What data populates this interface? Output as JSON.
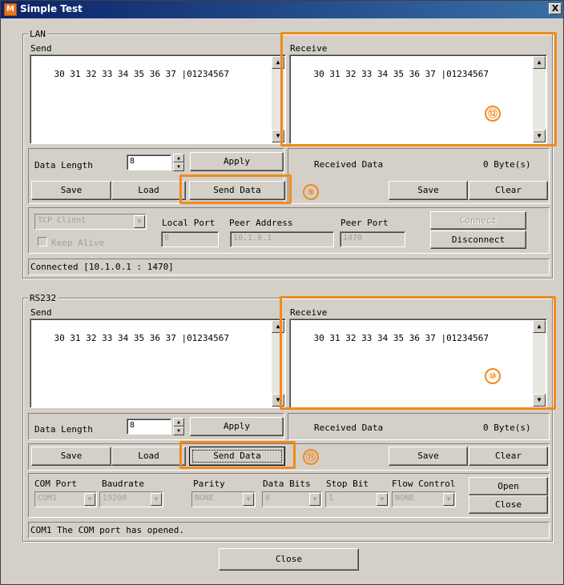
{
  "window": {
    "title": "Simple Test",
    "close_glyph": "X",
    "icon_letter": "M"
  },
  "lan": {
    "group_label": "LAN",
    "send_label": "Send",
    "send_text": "30 31 32 33 34 35 36 37 |01234567",
    "receive_label": "Receive",
    "receive_text": "30 31 32 33 34 35 36 37 |01234567",
    "data_length_label": "Data Length",
    "data_length_value": "8",
    "apply_label": "Apply",
    "received_data_label": "Received Data",
    "received_bytes": "0  Byte(s)",
    "save_label": "Save",
    "load_label": "Load",
    "send_data_label": "Send Data",
    "recv_save_label": "Save",
    "clear_label": "Clear",
    "mode_value": "TCP Client",
    "keep_alive_label": "Keep Alive",
    "local_port_label": "Local Port",
    "local_port_value": "0",
    "peer_address_label": "Peer Address",
    "peer_address_value": "10.1.0.1",
    "peer_port_label": "Peer Port",
    "peer_port_value": "1470",
    "connect_label": "Connect",
    "disconnect_label": "Disconnect",
    "status_text": "Connected [10.1.0.1 : 1470]"
  },
  "rs232": {
    "group_label": "RS232",
    "send_label": "Send",
    "send_text": "30 31 32 33 34 35 36 37 |01234567",
    "receive_label": "Receive",
    "receive_text": "30 31 32 33 34 35 36 37 |01234567",
    "data_length_label": "Data Length",
    "data_length_value": "8",
    "apply_label": "Apply",
    "received_data_label": "Received Data",
    "received_bytes": "0  Byte(s)",
    "save_label": "Save",
    "load_label": "Load",
    "send_data_label": "Send Data",
    "recv_save_label": "Save",
    "clear_label": "Clear",
    "com_port_label": "COM Port",
    "com_port_value": "COM1",
    "baudrate_label": "Baudrate",
    "baudrate_value": "19200",
    "parity_label": "Parity",
    "parity_value": "NONE",
    "data_bits_label": "Data Bits",
    "data_bits_value": "8",
    "stop_bit_label": "Stop Bit",
    "stop_bit_value": "1",
    "flow_control_label": "Flow Control",
    "flow_control_value": "NONE",
    "open_label": "Open",
    "close_label": "Close",
    "status_text": "COM1 The COM port has opened."
  },
  "footer": {
    "close_label": "Close"
  },
  "annotations": {
    "marker_9": "⑨",
    "marker_10": "⑩",
    "marker_11": "⑪",
    "marker_12": "⑫",
    "accent_color": "#f08a1c"
  }
}
